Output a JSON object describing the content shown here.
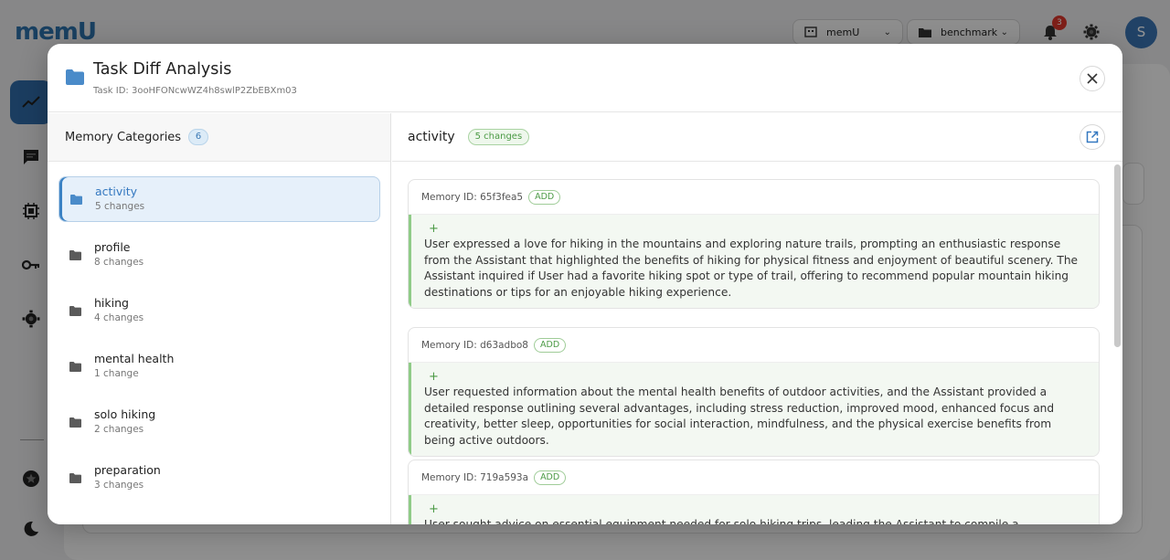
{
  "background": {
    "logo": "memU",
    "selectors": [
      {
        "label": "memU"
      },
      {
        "label": "benchmark"
      }
    ],
    "notification_count": "3",
    "avatar_initial": "S"
  },
  "modal": {
    "title": "Task Diff Analysis",
    "task_id": "Task ID: 3ooHFONcwWZ4h8swlP2ZbEBXm03"
  },
  "categories_panel": {
    "title": "Memory Categories",
    "count": "6",
    "items": [
      {
        "name": "activity",
        "changes": "5 changes"
      },
      {
        "name": "profile",
        "changes": "8 changes"
      },
      {
        "name": "hiking",
        "changes": "4 changes"
      },
      {
        "name": "mental health",
        "changes": "1 change"
      },
      {
        "name": "solo hiking",
        "changes": "2 changes"
      },
      {
        "name": "preparation",
        "changes": "3 changes"
      }
    ]
  },
  "detail_panel": {
    "title": "activity",
    "changes": "5 changes",
    "memories": [
      {
        "id": "Memory ID: 65f3fea5",
        "action": "ADD",
        "sign": "+",
        "text": "User expressed a love for hiking in the mountains and exploring nature trails, prompting an enthusiastic response from the Assistant that highlighted the benefits of hiking for physical fitness and enjoyment of beautiful scenery. The Assistant inquired if User had a favorite hiking spot or type of trail, offering to recommend popular mountain hiking destinations or tips for an enjoyable hiking experience."
      },
      {
        "id": "Memory ID: d63adbo8",
        "action": "ADD",
        "sign": "+",
        "text": "User requested information about the mental health benefits of outdoor activities, and the Assistant provided a detailed response outlining several advantages, including stress reduction, improved mood, enhanced focus and creativity, better sleep, opportunities for social interaction, mindfulness, and the physical exercise benefits from being active outdoors."
      },
      {
        "id": "Memory ID: 719a593a",
        "action": "ADD",
        "sign": "+",
        "text": "User sought advice on essential equipment needed for solo hiking trips, leading the Assistant to compile a"
      }
    ]
  },
  "colors": {
    "accent": "#3478c0",
    "add_green": "#4b9a45",
    "badge_red": "#d9362b"
  }
}
